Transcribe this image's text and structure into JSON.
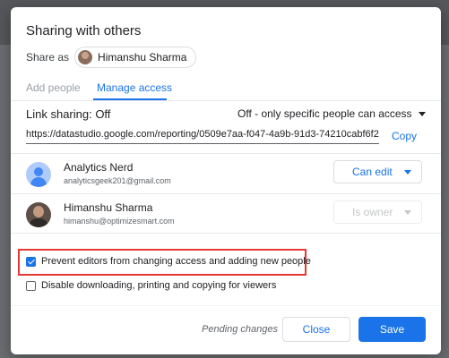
{
  "dialog": {
    "title": "Sharing with others",
    "share_as_label": "Share as",
    "share_as_user": "Himanshu Sharma"
  },
  "tabs": [
    {
      "label": "Add people",
      "active": false
    },
    {
      "label": "Manage access",
      "active": true
    }
  ],
  "link_sharing": {
    "label": "Link sharing: Off",
    "option": "Off - only specific people can access",
    "url": "https://datastudio.google.com/reporting/0509e7aa-f047-4a9b-91d3-74210cabf6f2",
    "copy_label": "Copy"
  },
  "people": [
    {
      "name": "Analytics Nerd",
      "email": "analyticsgeek201@gmail.com",
      "role": "Can edit",
      "avatar": "generic-person-icon",
      "role_enabled": true
    },
    {
      "name": "Himanshu Sharma",
      "email": "himanshu@optimizesmart.com",
      "role": "Is owner",
      "avatar": "photo",
      "role_enabled": false
    }
  ],
  "options": [
    {
      "label": "Prevent editors from changing access and adding new people",
      "checked": true
    },
    {
      "label": "Disable downloading, printing and copying for viewers",
      "checked": false
    }
  ],
  "footer": {
    "pending_text": "Pending changes",
    "close_label": "Close",
    "save_label": "Save"
  },
  "colors": {
    "accent": "#1a73e8",
    "highlight_border": "#e53935"
  }
}
